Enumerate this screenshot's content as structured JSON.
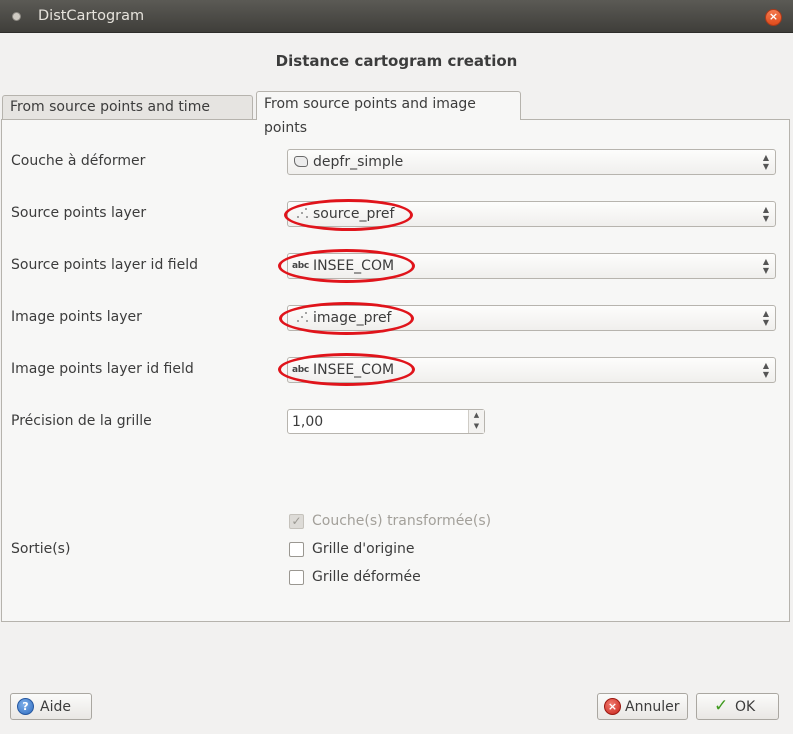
{
  "window": {
    "title": "DistCartogram"
  },
  "dialog": {
    "heading": "Distance cartogram creation"
  },
  "tabs": [
    {
      "label": "From source points and time matrix",
      "active": false
    },
    {
      "label": "From source points and image points",
      "active": true
    }
  ],
  "form": {
    "layer_to_deform": {
      "label": "Couche à déformer",
      "value": "depfr_simple",
      "icon": "polygon-layer-icon"
    },
    "source_points_layer": {
      "label": "Source points layer",
      "value": "source_pref",
      "icon": "point-layer-icon"
    },
    "source_points_id_field": {
      "label": "Source points layer id field",
      "value": "INSEE_COM",
      "icon": "abc"
    },
    "image_points_layer": {
      "label": "Image points layer",
      "value": "image_pref",
      "icon": "point-layer-icon"
    },
    "image_points_id_field": {
      "label": "Image points layer id field",
      "value": "INSEE_COM",
      "icon": "abc"
    },
    "grid_precision": {
      "label": "Précision de la grille",
      "value": "1,00"
    }
  },
  "outputs": {
    "label": "Sortie(s)",
    "options": [
      {
        "label": "Couche(s) transformée(s)",
        "checked": true,
        "disabled": true
      },
      {
        "label": "Grille d'origine",
        "checked": false,
        "disabled": false
      },
      {
        "label": "Grille déformée",
        "checked": false,
        "disabled": false
      }
    ]
  },
  "buttons": {
    "help": "Aide",
    "cancel": "Annuler",
    "ok": "OK"
  },
  "highlight_color": "#e0141b"
}
